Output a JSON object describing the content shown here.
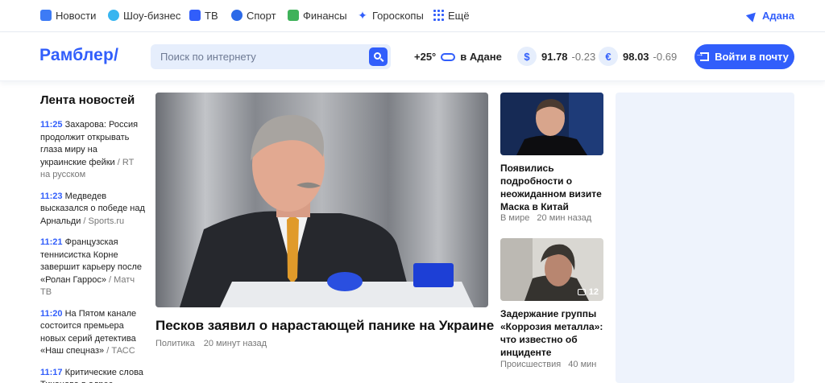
{
  "topnav": {
    "items": [
      {
        "label": "Новости",
        "icon": "news-icon"
      },
      {
        "label": "Шоу-бизнес",
        "icon": "showbiz-icon"
      },
      {
        "label": "ТВ",
        "icon": "tv-icon"
      },
      {
        "label": "Спорт",
        "icon": "sport-icon"
      },
      {
        "label": "Финансы",
        "icon": "finance-icon"
      },
      {
        "label": "Гороскопы",
        "icon": "horoscope-icon"
      },
      {
        "label": "Ещё",
        "icon": "grid-icon"
      }
    ],
    "city": "Адана"
  },
  "header": {
    "logo": "Рамблер/",
    "search_placeholder": "Поиск по интернету",
    "weather_temp": "+25°",
    "weather_city": "в Адане",
    "usd": {
      "symbol": "$",
      "value": "91.78",
      "change": "-0.23"
    },
    "eur": {
      "symbol": "€",
      "value": "98.03",
      "change": "-0.69"
    },
    "mail_button": "Войти в почту"
  },
  "feed": {
    "title": "Лента новостей",
    "items": [
      {
        "time": "11:25",
        "text": "Захарова: Россия продолжит открывать глаза миру на украинские фейки",
        "source": "/ RT на русском"
      },
      {
        "time": "11:23",
        "text": "Медведев высказался о победе над Арнальди",
        "source": "/ Sports.ru"
      },
      {
        "time": "11:21",
        "text": "Французская теннисистка Корне завершит карьеру после «Ролан Гаррос»",
        "source": "/ Матч ТВ"
      },
      {
        "time": "11:20",
        "text": "На Пятом канале состоится премьера новых серий детектива «Наш спецназ»",
        "source": "/ ТАСС"
      },
      {
        "time": "11:17",
        "text": "Критические слова Тихонова в адрес",
        "source": ""
      }
    ]
  },
  "main_story": {
    "title": "Песков заявил о нарастающей панике на Украине",
    "category": "Политика",
    "time": "20 минут назад"
  },
  "side_stories": [
    {
      "title": "Появились подробности о неожиданном визите Маска в Китай",
      "category": "В мире",
      "time": "20 мин назад"
    },
    {
      "title": "Задержание группы «Коррозия металла»: что известно об инциденте",
      "category": "Происшествия",
      "time": "40 мин",
      "comments": "12"
    }
  ],
  "colors": {
    "accent": "#315efb",
    "meta": "#777777",
    "ad_bg": "#eef3fc"
  }
}
